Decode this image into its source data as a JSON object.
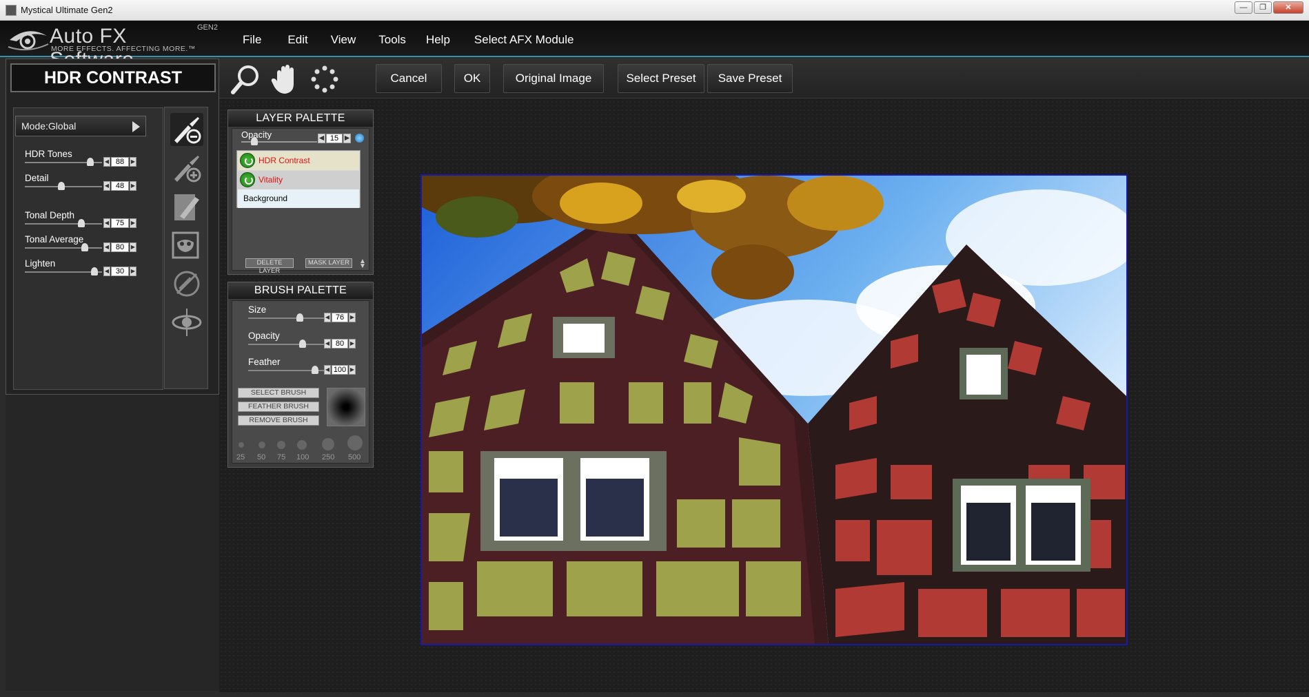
{
  "window": {
    "title": "Mystical Ultimate Gen2",
    "buttons": {
      "minimize": "—",
      "maximize": "❐",
      "close": "✕"
    }
  },
  "logo": {
    "brand": "Auto FX Software",
    "tagline": "MORE EFFECTS. AFFECTING MORE.™",
    "gen": "GEN2"
  },
  "menu": {
    "items": [
      "File",
      "Edit",
      "View",
      "Tools",
      "Help",
      "Select AFX Module"
    ]
  },
  "filter": {
    "title": "HDR CONTRAST",
    "mode": "Mode:Global"
  },
  "sliders": [
    {
      "label": "HDR Tones",
      "value": "88"
    },
    {
      "label": "Detail",
      "value": "48"
    },
    {
      "label": "Tonal Depth",
      "value": "75"
    },
    {
      "label": "Tonal Average",
      "value": "80"
    },
    {
      "label": "Lighten",
      "value": "30"
    }
  ],
  "toolbar": {
    "cancel": "Cancel",
    "ok": "OK",
    "original": "Original Image",
    "select_preset": "Select Preset",
    "save_preset": "Save Preset"
  },
  "layer_palette": {
    "title": "LAYER PALETTE",
    "opacity_label": "Opacity",
    "opacity_value": "15",
    "layers": [
      "HDR Contrast",
      "Vitality",
      "Background"
    ],
    "delete": "DELETE LAYER",
    "mask": "MASK LAYER"
  },
  "brush_palette": {
    "title": "BRUSH PALETTE",
    "sliders": [
      {
        "label": "Size",
        "value": "76"
      },
      {
        "label": "Opacity",
        "value": "80"
      },
      {
        "label": "Feather",
        "value": "100"
      }
    ],
    "buttons": [
      "SELECT BRUSH",
      "FEATHER BRUSH",
      "REMOVE BRUSH"
    ],
    "sizes": [
      "25",
      "50",
      "75",
      "100",
      "250",
      "500"
    ]
  },
  "colors": {
    "accent": "#3a8fb0",
    "layer_red": "#e01010",
    "image_border": "#1919a8"
  }
}
